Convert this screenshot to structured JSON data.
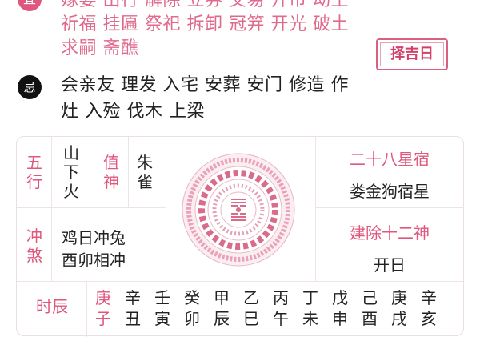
{
  "yi": {
    "badge": "宜",
    "lines": [
      "嫁娶 出行 解除 立券 交易 开市 动土",
      "祈福 挂匾 祭祀 拆卸 冠笄 开光 破土",
      "求嗣 斋醮"
    ]
  },
  "zeji_button": "择吉日",
  "ji": {
    "badge": "忌",
    "lines": [
      "会亲友 理发 入宅 安葬 安门 修造 作",
      "灶 入殓 伐木 上梁"
    ]
  },
  "wuxing": {
    "label": "五行",
    "value": "山下火"
  },
  "zhishen": {
    "label": "值神",
    "value": "朱雀"
  },
  "xiu": {
    "title": "二十八星宿",
    "value": "娄金狗宿星"
  },
  "chongsha": {
    "label": "冲煞",
    "lines": [
      "鸡日冲兔",
      "酉卯相冲"
    ]
  },
  "jianchu": {
    "title": "建除十二神",
    "value": "开日"
  },
  "shichen": {
    "label": "时辰",
    "columns": [
      {
        "stem": "庚",
        "branch": "子",
        "highlight": true
      },
      {
        "stem": "辛",
        "branch": "丑",
        "highlight": false
      },
      {
        "stem": "壬",
        "branch": "寅",
        "highlight": false
      },
      {
        "stem": "癸",
        "branch": "卯",
        "highlight": false
      },
      {
        "stem": "甲",
        "branch": "辰",
        "highlight": false
      },
      {
        "stem": "乙",
        "branch": "巳",
        "highlight": false
      },
      {
        "stem": "丙",
        "branch": "午",
        "highlight": false
      },
      {
        "stem": "丁",
        "branch": "未",
        "highlight": false
      },
      {
        "stem": "戊",
        "branch": "申",
        "highlight": false
      },
      {
        "stem": "己",
        "branch": "酉",
        "highlight": false
      },
      {
        "stem": "庚",
        "branch": "戌",
        "highlight": false
      },
      {
        "stem": "辛",
        "branch": "亥",
        "highlight": false
      }
    ]
  },
  "colors": {
    "accent": "#e0577e",
    "yi_text": "#e06a8c",
    "ji_badge": "#111111",
    "border": "#eadfe2"
  }
}
